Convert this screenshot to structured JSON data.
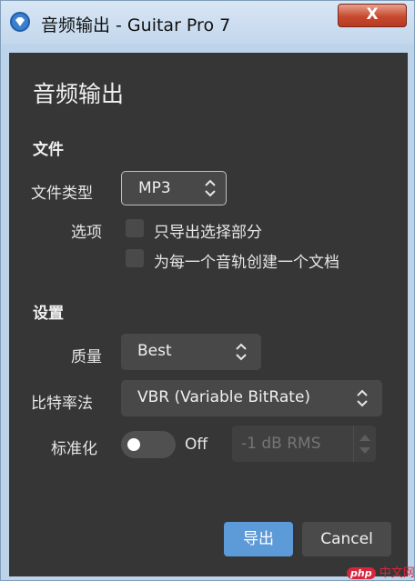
{
  "window": {
    "title": "音频输出 - Guitar Pro 7",
    "close_label": "X"
  },
  "dialog": {
    "heading": "音频输出",
    "file_section": {
      "title": "文件",
      "file_type_label": "文件类型",
      "file_type_value": "MP3",
      "options_label": "选项",
      "option_export_selection": "只导出选择部分",
      "option_per_track": "为每一个音轨创建一个文档"
    },
    "settings_section": {
      "title": "设置",
      "quality_label": "质量",
      "quality_value": "Best",
      "bitrate_label": "比特率法",
      "bitrate_value": "VBR (Variable BitRate)",
      "normalize_label": "标准化",
      "normalize_state": "Off",
      "normalize_placeholder": "-1 dB RMS"
    },
    "buttons": {
      "export": "导出",
      "cancel": "Cancel"
    }
  },
  "watermark": {
    "php": "php",
    "cn": "中文网"
  },
  "colors": {
    "dialog_bg": "#363636",
    "accent": "#5d9ad8",
    "title_bar": "#c3d7ec"
  }
}
